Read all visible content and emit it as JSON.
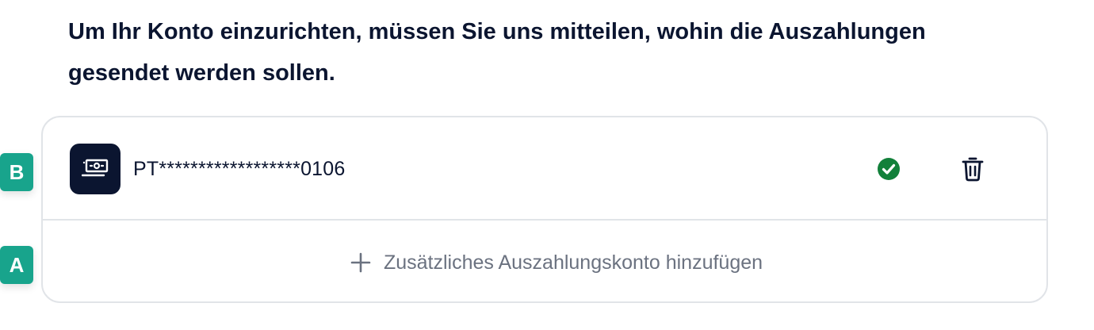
{
  "intro": {
    "line1": "Um Ihr Konto einzurichten, müssen Sie uns mitteilen, wohin die Auszahlungen",
    "line2": "gesendet werden sollen."
  },
  "account": {
    "number": "PT******************0106",
    "bank_icon": "bank-card-icon",
    "verified_icon": "check-circle-icon",
    "verified_color": "#12803a",
    "delete_icon": "trash-icon"
  },
  "add_account": {
    "icon": "plus-icon",
    "label": "Zusätzliches Auszahlungskonto hinzufügen"
  },
  "markers": {
    "b": "B",
    "a": "A",
    "color": "#18a48c"
  },
  "colors": {
    "text_primary": "#0b1530",
    "text_muted": "#6b7280",
    "border": "#e1e4e8"
  }
}
